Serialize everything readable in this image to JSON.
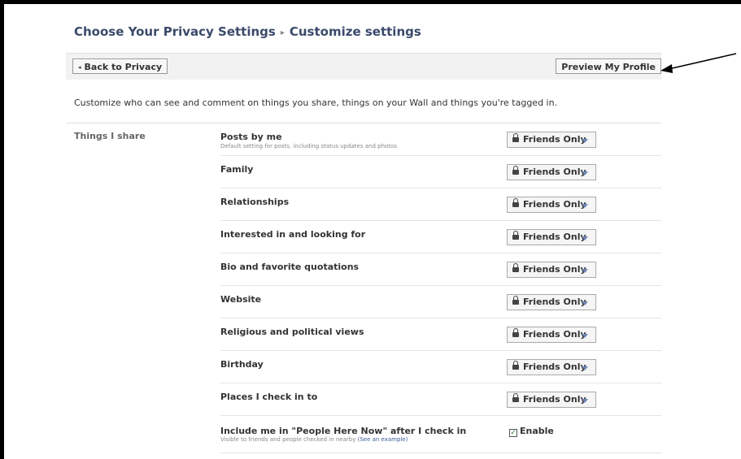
{
  "header": {
    "title": "Choose Your Privacy Settings",
    "separator": "▸",
    "subtitle": "Customize settings"
  },
  "toolbar": {
    "back_label": "Back to Privacy",
    "back_arrow": "◂",
    "preview_label": "Preview My Profile"
  },
  "intro_text": "Customize who can see and comment on things you share, things on your Wall and things you're tagged in.",
  "section": {
    "label": "Things I share",
    "rows": [
      {
        "label": "Posts by me",
        "sub": "Default setting for posts, including status updates and photos",
        "value": "Friends Only"
      },
      {
        "label": "Family",
        "value": "Friends Only"
      },
      {
        "label": "Relationships",
        "value": "Friends Only"
      },
      {
        "label": "Interested in and looking for",
        "value": "Friends Only"
      },
      {
        "label": "Bio and favorite quotations",
        "value": "Friends Only"
      },
      {
        "label": "Website",
        "value": "Friends Only"
      },
      {
        "label": "Religious and political views",
        "value": "Friends Only"
      },
      {
        "label": "Birthday",
        "value": "Friends Only"
      },
      {
        "label": "Places I check in to",
        "value": "Friends Only"
      }
    ],
    "checkin_row": {
      "label": "Include me in \"People Here Now\" after I check in",
      "sub": "Visible to friends and people checked in nearby",
      "sub_link": "(See an example)",
      "checkbox_label": "Enable",
      "checked": true,
      "check_mark": "✓"
    }
  },
  "icons": {
    "lock": "lock-icon",
    "caret": "chevron-down-icon",
    "annotation": "arrow-annotation"
  },
  "colors": {
    "title": "#3b4a6b",
    "link": "#3b5998",
    "caret": "#6d84b4",
    "check": "#2a7a2a"
  }
}
